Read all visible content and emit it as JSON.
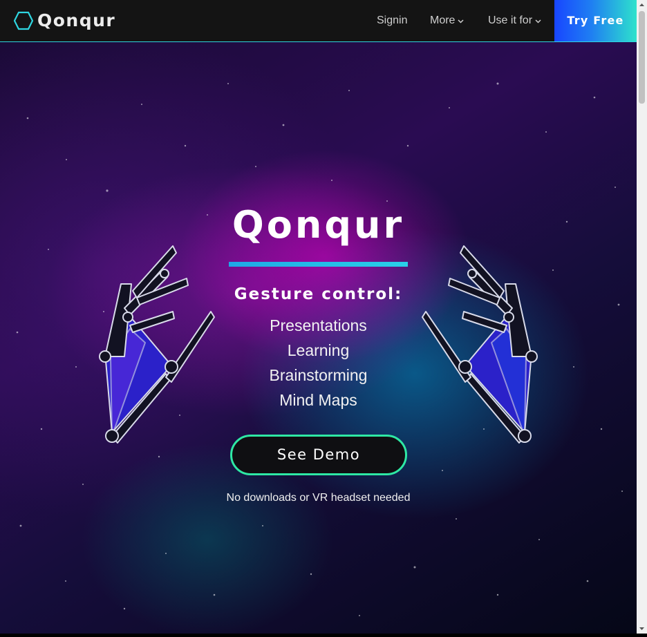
{
  "header": {
    "logo_icon": "hexagon-icon",
    "brand": "Qonqur",
    "nav": {
      "signin": "Signin",
      "more": "More",
      "use_it_for": "Use it for",
      "try_free": "Try Free"
    }
  },
  "hero": {
    "title": "Qonqur",
    "subtitle": "Gesture control:",
    "uses": [
      "Presentations",
      "Learning",
      "Brainstorming",
      "Mind Maps"
    ],
    "cta": "See Demo",
    "note": "No downloads or VR headset needed"
  },
  "colors": {
    "accent_cyan": "#2fd6e0",
    "cta_border": "#2ee8a4",
    "try_free_gradient": [
      "#1846ff",
      "#2ee2cc"
    ]
  }
}
